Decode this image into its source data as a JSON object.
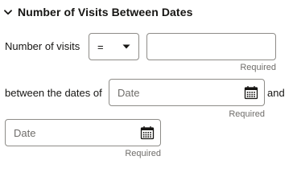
{
  "section": {
    "title": "Number of Visits Between Dates",
    "expanded": true
  },
  "visits": {
    "label": "Number of visits",
    "operator": "=",
    "value": "",
    "required_text": "Required"
  },
  "date_from": {
    "label": "between the dates of",
    "placeholder": "Date",
    "value": "",
    "required_text": "Required"
  },
  "conjunction": "and",
  "date_to": {
    "placeholder": "Date",
    "value": "",
    "required_text": "Required"
  },
  "icons": {
    "collapse": "chevron-down-icon",
    "dropdown": "caret-down-icon",
    "calendar": "calendar-icon"
  }
}
